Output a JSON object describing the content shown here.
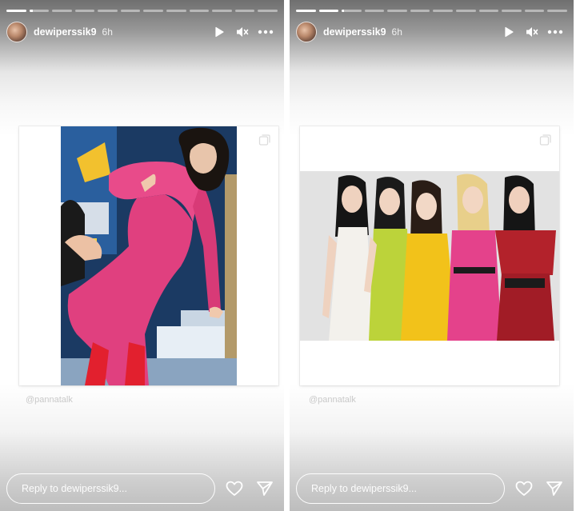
{
  "stories": [
    {
      "progress": [
        1.0,
        0.2,
        0,
        0,
        0,
        0,
        0,
        0,
        0,
        0,
        0,
        0
      ],
      "username": "dewiperssik9",
      "time": "6h",
      "watermark": "@pannatalk",
      "reply_placeholder": "Reply to dewiperssik9..."
    },
    {
      "progress": [
        1.0,
        1.0,
        0.1,
        0,
        0,
        0,
        0,
        0,
        0,
        0,
        0,
        0
      ],
      "username": "dewiperssik9",
      "time": "6h",
      "watermark": "@pannatalk",
      "reply_placeholder": "Reply to dewiperssik9..."
    }
  ],
  "icons": {
    "play": "play-icon",
    "mute": "mute-icon",
    "more": "more-icon",
    "like": "heart-icon",
    "send": "send-icon",
    "multi": "multiple-photos-icon"
  },
  "colors": {
    "pink_dress": "#e4428b",
    "yellow": "#f2c21a",
    "lime": "#bcd33a",
    "red": "#b3222b"
  }
}
